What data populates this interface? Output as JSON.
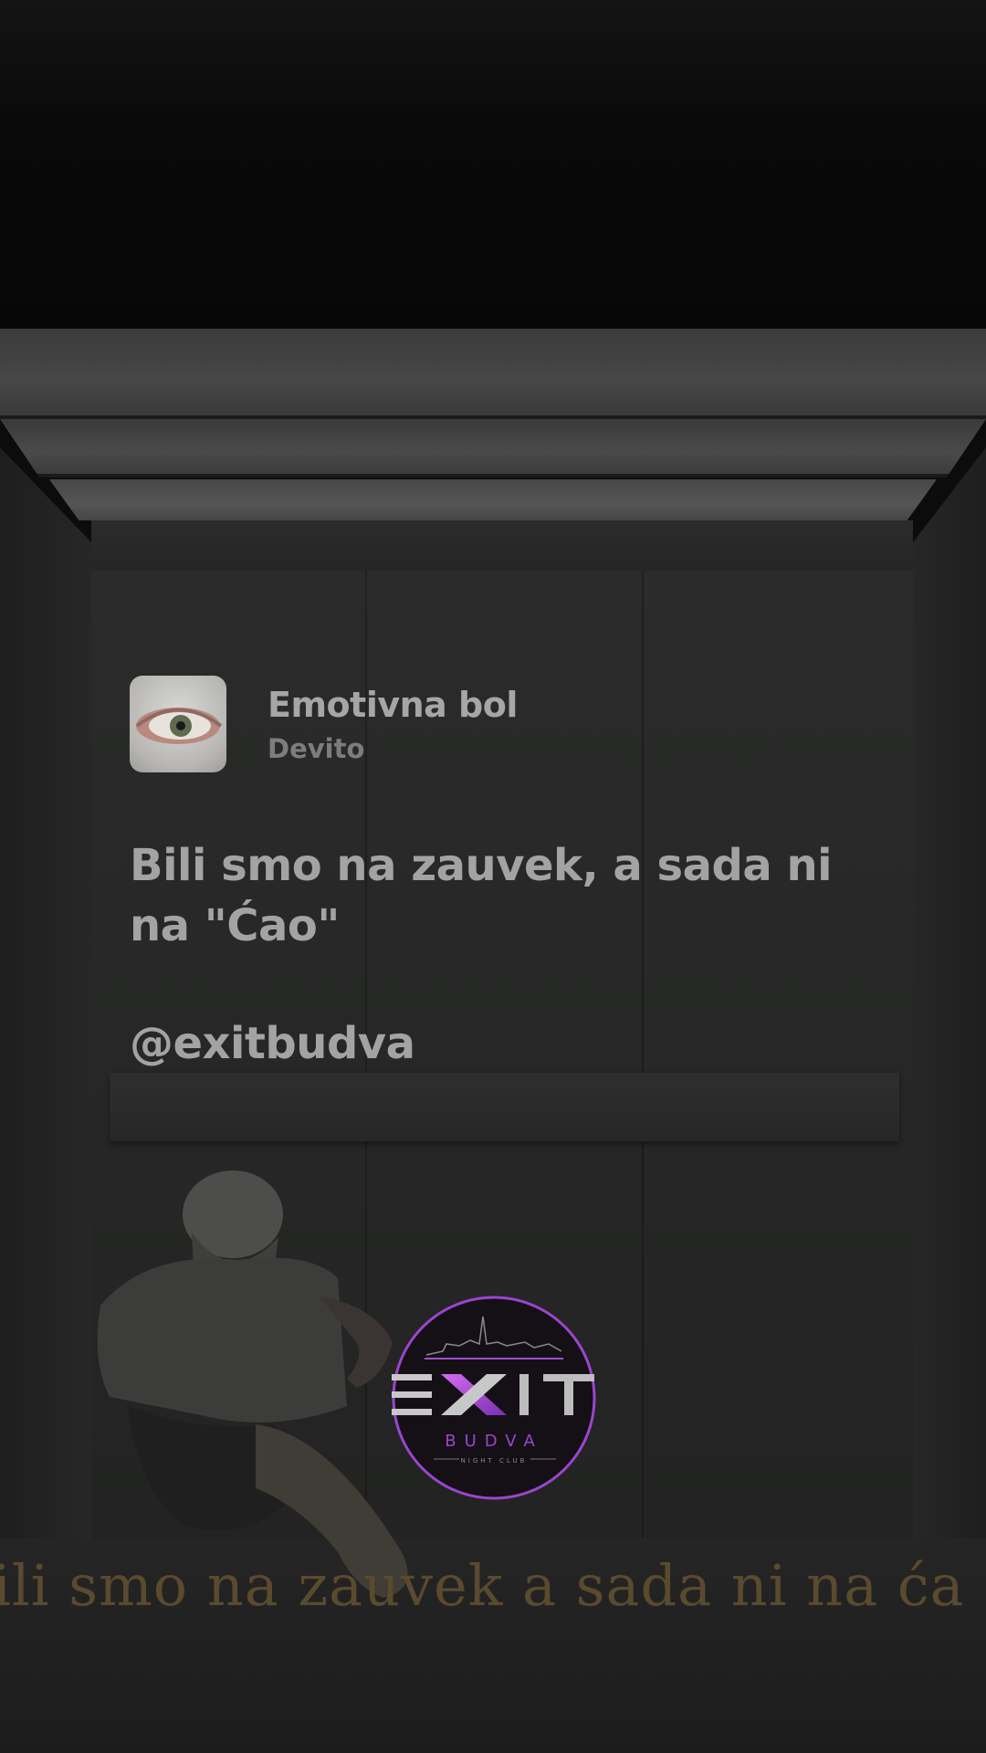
{
  "song": {
    "title": "Emotivna bol",
    "artist": "Devito"
  },
  "lyric": {
    "line1": "Bili smo na zauvek, a sada ni",
    "line2": "na \"Ćao\""
  },
  "handle": "@exitbudva",
  "logo": {
    "wordmark": "EXIT",
    "city": "BUDVA",
    "tagline": "NIGHT CLUB"
  },
  "subtitle": "ili smo na zauvek a sada ni na ća",
  "colors": {
    "accent": "#a44ad6",
    "text": "#a3a3a3",
    "subtitle": "#5a4a2e"
  }
}
